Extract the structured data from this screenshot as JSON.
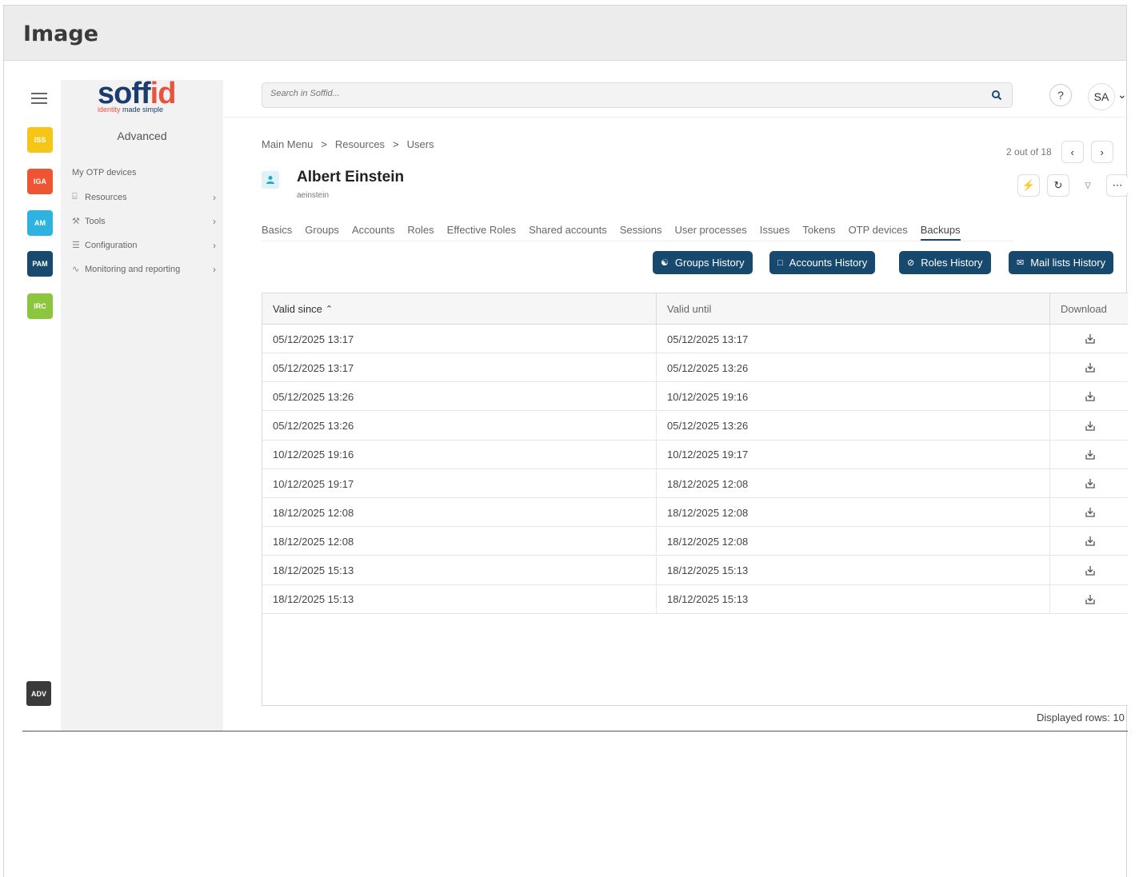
{
  "frame": {
    "title": "Image"
  },
  "rail": {
    "modules": [
      {
        "label": "ISS",
        "color": "#f5c518"
      },
      {
        "label": "IGA",
        "color": "#ef5533"
      },
      {
        "label": "AM",
        "color": "#2eb3e0"
      },
      {
        "label": "PAM",
        "color": "#174a6e"
      },
      {
        "label": "IRC",
        "color": "#8cc63f"
      }
    ],
    "adv_label": "ADV"
  },
  "sidebar": {
    "logo_main": "soff",
    "logo_accent": "id",
    "logo_tag_red": "identity",
    "logo_tag_rest": " made simple",
    "title": "Advanced",
    "items": [
      {
        "label": "My OTP devices",
        "icon": "none",
        "has_chevron": false
      },
      {
        "label": "Resources",
        "icon": "database-icon",
        "has_chevron": true
      },
      {
        "label": "Tools",
        "icon": "wrench-icon",
        "has_chevron": true
      },
      {
        "label": "Configuration",
        "icon": "sliders-icon",
        "has_chevron": true
      },
      {
        "label": "Monitoring and reporting",
        "icon": "trend-icon",
        "has_chevron": true
      }
    ]
  },
  "topbar": {
    "search_placeholder": "Search in Soffid...",
    "help_label": "?",
    "avatar_initials": "SA"
  },
  "breadcrumb": [
    "Main Menu",
    "Resources",
    "Users"
  ],
  "breadcrumb_sep": ">",
  "pager": {
    "text": "2 out of 18"
  },
  "user": {
    "name": "Albert Einstein",
    "login": "aeinstein"
  },
  "tabs": [
    {
      "label": "Basics",
      "active": false
    },
    {
      "label": "Groups",
      "active": false
    },
    {
      "label": "Accounts",
      "active": false
    },
    {
      "label": "Roles",
      "active": false
    },
    {
      "label": "Effective Roles",
      "active": false
    },
    {
      "label": "Shared accounts",
      "active": false
    },
    {
      "label": "Sessions",
      "active": false
    },
    {
      "label": "User processes",
      "active": false
    },
    {
      "label": "Issues",
      "active": false
    },
    {
      "label": "Tokens",
      "active": false
    },
    {
      "label": "OTP devices",
      "active": false
    },
    {
      "label": "Backups",
      "active": true
    }
  ],
  "actions": {
    "groups_history": "Groups History",
    "accounts_history": "Accounts History",
    "roles_history": "Roles History",
    "mail_lists_history": "Mail lists History"
  },
  "table": {
    "columns": {
      "valid_since": "Valid since",
      "valid_until": "Valid until",
      "download": "Download"
    },
    "rows": [
      {
        "since": "05/12/2025 13:17",
        "until": "05/12/2025 13:17"
      },
      {
        "since": "05/12/2025 13:17",
        "until": "05/12/2025 13:26"
      },
      {
        "since": "05/12/2025 13:26",
        "until": "10/12/2025 19:16"
      },
      {
        "since": "05/12/2025 13:26",
        "until": "05/12/2025 13:26"
      },
      {
        "since": "10/12/2025 19:16",
        "until": "10/12/2025 19:17"
      },
      {
        "since": "10/12/2025 19:17",
        "until": "18/12/2025 12:08"
      },
      {
        "since": "18/12/2025 12:08",
        "until": "18/12/2025 12:08"
      },
      {
        "since": "18/12/2025 12:08",
        "until": "18/12/2025 12:08"
      },
      {
        "since": "18/12/2025 15:13",
        "until": "18/12/2025 15:13"
      },
      {
        "since": "18/12/2025 15:13",
        "until": "18/12/2025 15:13"
      }
    ],
    "footer": "Displayed rows: 10"
  },
  "colors": {
    "primary": "#17496f",
    "logo_blue": "#1a3d6d",
    "logo_red": "#e8533d"
  }
}
